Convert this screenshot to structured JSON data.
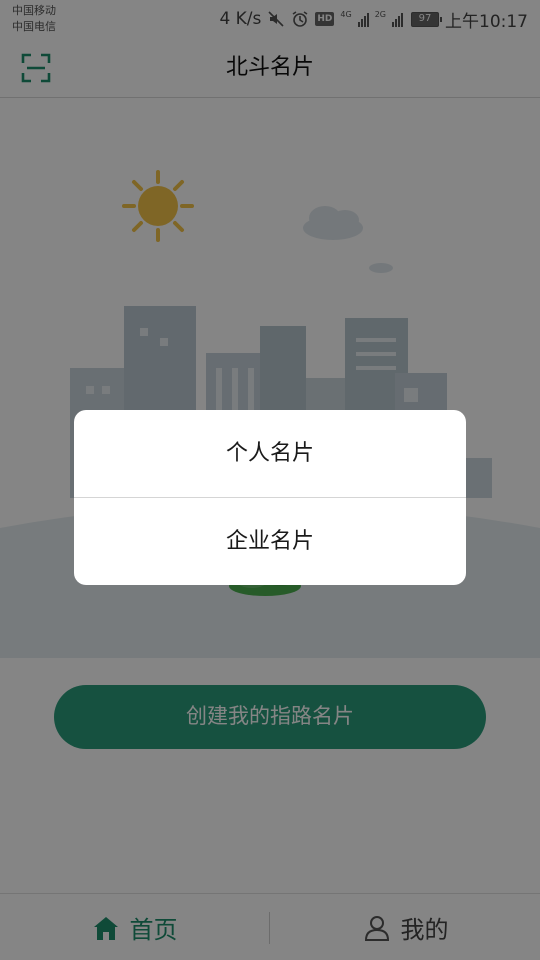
{
  "status_bar": {
    "carrier_1": "中国移动",
    "carrier_2": "中国电信",
    "speed": "4 K/s",
    "hd_label": "HD",
    "net_1": "4G",
    "net_2": "2G",
    "battery": "97",
    "time": "上午10:17",
    "icons": [
      "mute-icon",
      "alarm-icon",
      "signal-icon",
      "battery-icon"
    ]
  },
  "title_bar": {
    "title": "北斗名片",
    "scan_icon": "scan-icon"
  },
  "main": {
    "create_button_label": "创建我的指路名片"
  },
  "dialog": {
    "options": [
      "个人名片",
      "企业名片"
    ]
  },
  "bottom_nav": {
    "items": [
      {
        "label": "首页",
        "icon": "home-icon",
        "active": true
      },
      {
        "label": "我的",
        "icon": "user-icon",
        "active": false
      }
    ]
  },
  "colors": {
    "accent": "#1d8f6c",
    "button": "#2b9c7b",
    "overlay": "rgba(0,0,0,0.48)"
  }
}
